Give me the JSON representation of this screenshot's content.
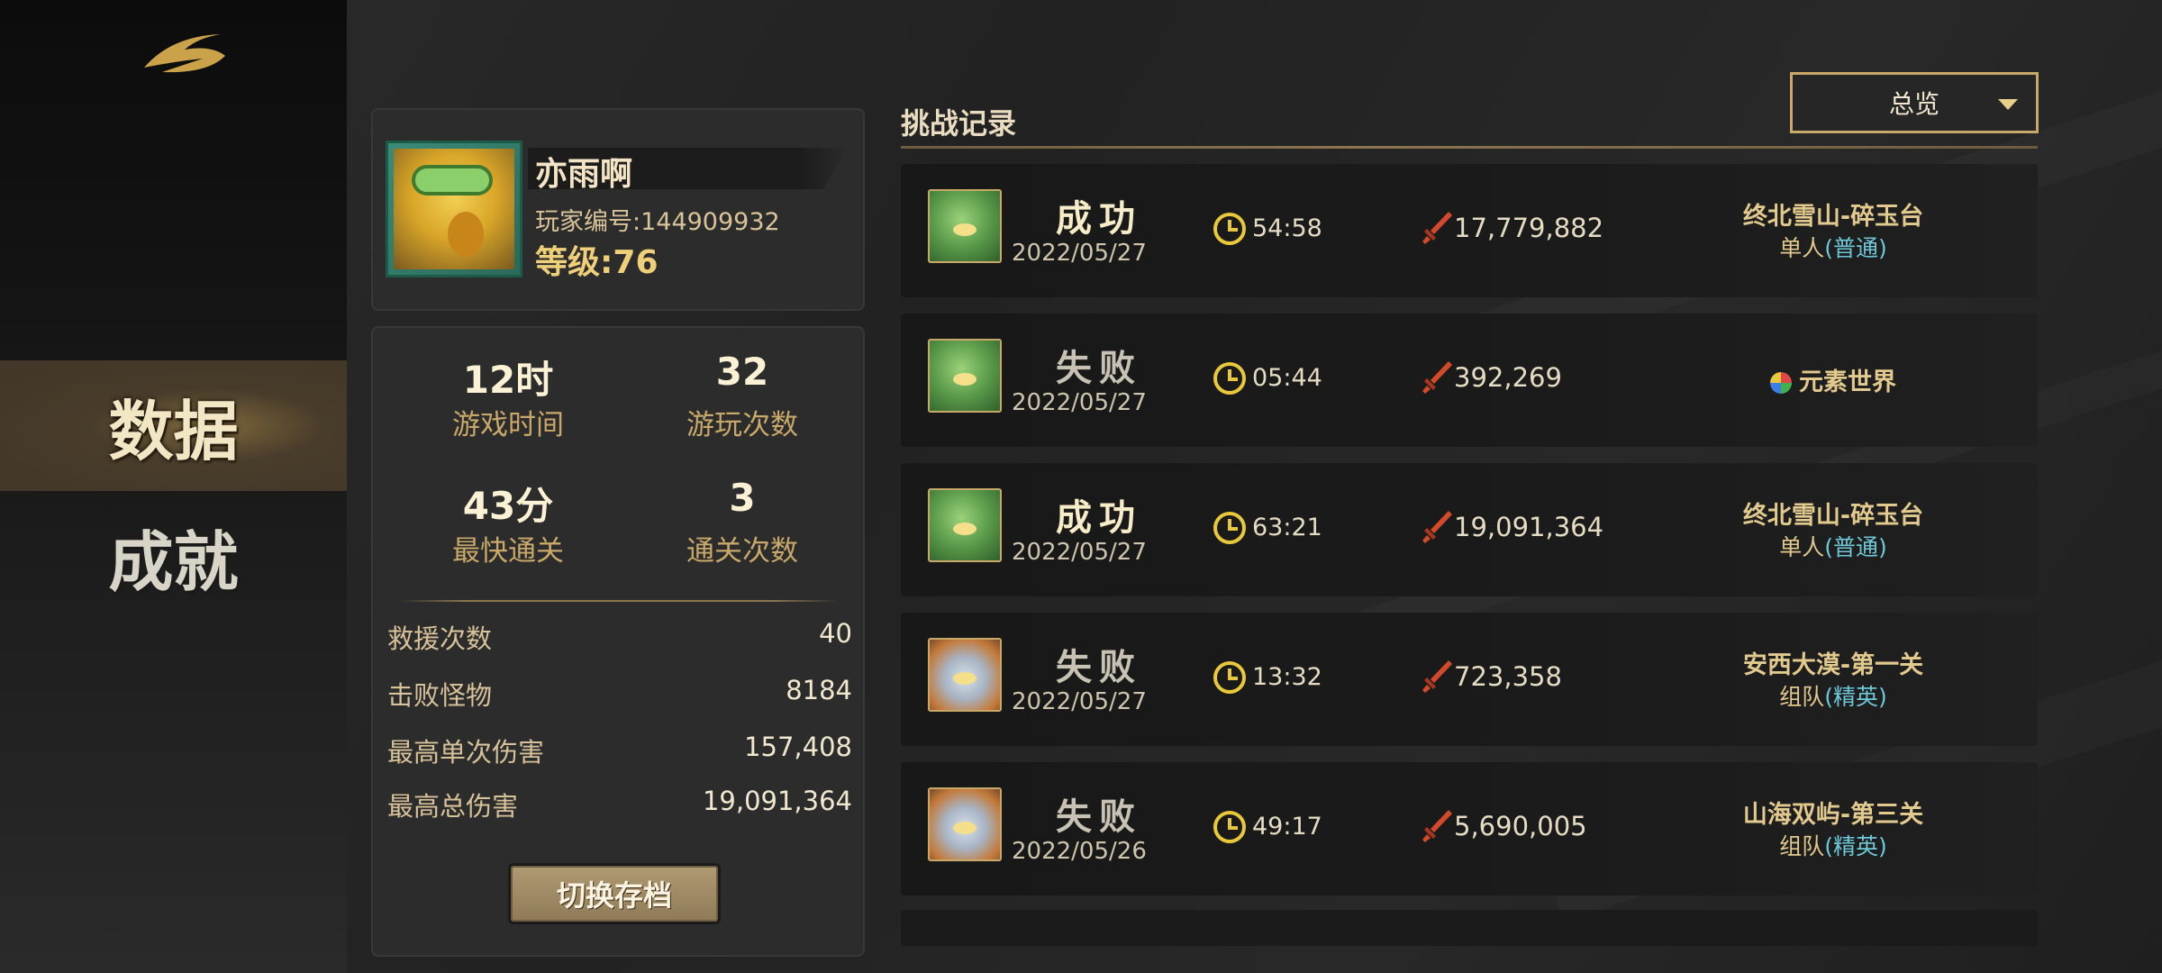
{
  "sidebar": {
    "items": [
      {
        "label": "数据",
        "active": true
      },
      {
        "label": "成就",
        "active": false
      }
    ]
  },
  "profile": {
    "name": "亦雨啊",
    "player_id": "玩家编号:144909932",
    "level": "等级:76"
  },
  "stats": {
    "play_time": {
      "value": "12时",
      "label": "游戏时间"
    },
    "play_count": {
      "value": "32",
      "label": "游玩次数"
    },
    "fastest_clear": {
      "value": "43分",
      "label": "最快通关"
    },
    "clear_count": {
      "value": "3",
      "label": "通关次数"
    },
    "rows": [
      {
        "key": "救援次数",
        "value": "40"
      },
      {
        "key": "击败怪物",
        "value": "8184"
      },
      {
        "key": "最高单次伤害",
        "value": "157,408"
      },
      {
        "key": "最高总伤害",
        "value": "19,091,364"
      }
    ],
    "switch_button": "切换存档"
  },
  "records": {
    "title": "挑战记录",
    "filter": "总览",
    "items": [
      {
        "avatar": "green",
        "result": "成功",
        "win": true,
        "date": "2022/05/27",
        "time": "54:58",
        "damage": "17,779,882",
        "stage": "终北雪山-碎玉台",
        "mode_prefix": "单人",
        "mode_paren": "(普通)"
      },
      {
        "avatar": "green",
        "result": "失败",
        "win": false,
        "date": "2022/05/27",
        "time": "05:44",
        "damage": "392,269",
        "world": "元素世界"
      },
      {
        "avatar": "green",
        "result": "成功",
        "win": true,
        "date": "2022/05/27",
        "time": "63:21",
        "damage": "19,091,364",
        "stage": "终北雪山-碎玉台",
        "mode_prefix": "单人",
        "mode_paren": "(普通)"
      },
      {
        "avatar": "white",
        "result": "失败",
        "win": false,
        "date": "2022/05/27",
        "time": "13:32",
        "damage": "723,358",
        "stage": "安西大漠-第一关",
        "mode_prefix": "组队",
        "mode_paren": "(精英)"
      },
      {
        "avatar": "white",
        "result": "失败",
        "win": false,
        "date": "2022/05/26",
        "time": "49:17",
        "damage": "5,690,005",
        "stage": "山海双屿-第三关",
        "mode_prefix": "组队",
        "mode_paren": "(精英)"
      }
    ]
  },
  "colors": {
    "gold": "#c9a96a",
    "cyan": "#6ec8d8",
    "clock": "#e9c93a",
    "sword": "#d24a2a"
  }
}
